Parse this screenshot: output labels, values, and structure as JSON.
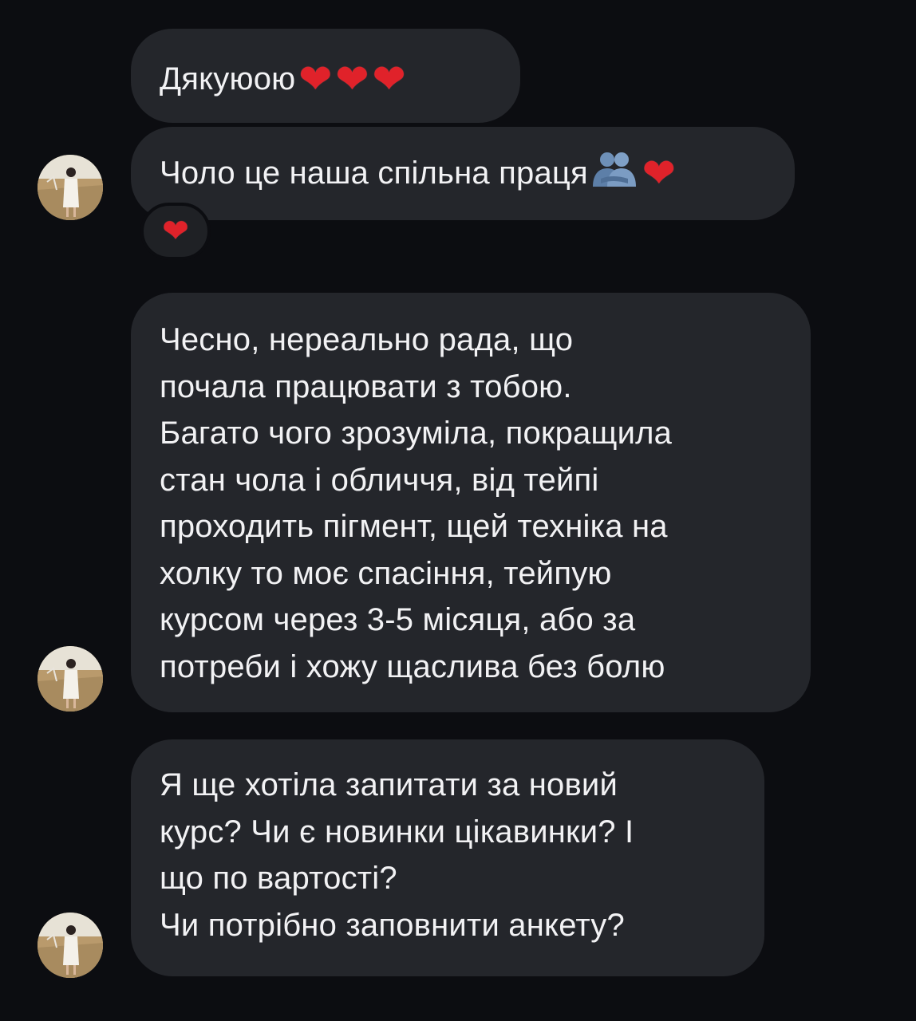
{
  "colors": {
    "background": "#0c0d11",
    "bubble": "#24262b",
    "text": "#f2f2f4",
    "heart": "#e0222a",
    "people_emoji": "#6e90b8"
  },
  "messages": [
    {
      "id": "m1",
      "text": "Дякуюою",
      "emojis": [
        "❤",
        "❤",
        "❤"
      ]
    },
    {
      "id": "m2",
      "text": "Чоло це наша спільна праця",
      "inline_icon": "people-hugging-icon",
      "emojis": [
        "❤"
      ],
      "reaction": "❤"
    },
    {
      "id": "m3",
      "text": "Чесно, нереально рада, що\nпочала працювати з тобою.\nБагато чого зрозуміла, покращила\nстан чола і обличчя, від тейпі\nпроходить пігмент, щей техніка на\nхолку то моє спасіння, тейпую\nкурсом через 3-5 місяця, або за\nпотреби і хожу щаслива без болю"
    },
    {
      "id": "m4",
      "text": "Я ще хотіла запитати за новий\nкурс? Чи є новинки цікавинки? І\nщо по вартості?\nЧи потрібно заповнити анкету?"
    }
  ]
}
